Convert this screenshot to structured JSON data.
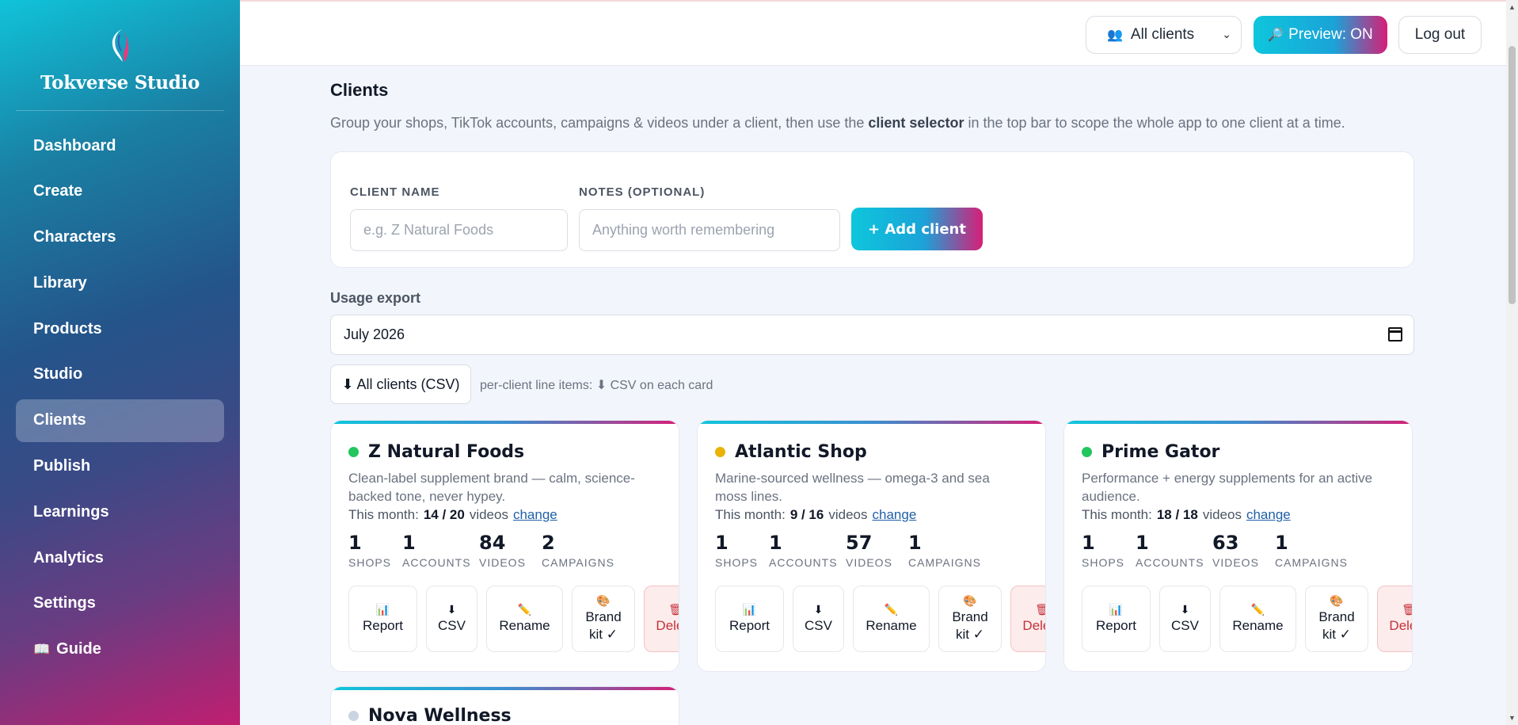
{
  "app": {
    "name": "Tokverse Studio",
    "accent_cyan": "#0ec6dc",
    "accent_pink": "#d61f77"
  },
  "sidebar": {
    "items": [
      {
        "label": "Dashboard"
      },
      {
        "label": "Create"
      },
      {
        "label": "Characters"
      },
      {
        "label": "Library"
      },
      {
        "label": "Products"
      },
      {
        "label": "Studio"
      },
      {
        "label": "Clients",
        "active": true
      },
      {
        "label": "Publish"
      },
      {
        "label": "Learnings"
      },
      {
        "label": "Analytics"
      },
      {
        "label": "Settings"
      },
      {
        "label": "Guide",
        "icon": "📖"
      }
    ]
  },
  "topbar": {
    "client_select": {
      "icon": "👥",
      "value": "All clients"
    },
    "preview": {
      "icon": "🔎",
      "label": "Preview: ON"
    },
    "logout": "Log out"
  },
  "page": {
    "title": "Clients",
    "desc_pre": "Group your shops, TikTok accounts, campaigns & videos under a client, then use the ",
    "desc_bold": "client selector",
    "desc_post": " in the top bar to scope the whole app to one client at a time."
  },
  "form": {
    "name_label": "CLIENT NAME",
    "name_placeholder": "e.g. Z Natural Foods",
    "notes_label": "NOTES (OPTIONAL)",
    "notes_placeholder": "Anything worth remembering",
    "add_button": "+ Add client"
  },
  "usage": {
    "label": "Usage export",
    "month": "July  2026",
    "csv_all_button": "⬇ All clients (CSV)",
    "hint": "per-client line items: ⬇ CSV on each card"
  },
  "stat_labels": [
    "SHOPS",
    "ACCOUNTS",
    "VIDEOS",
    "CAMPAIGNS"
  ],
  "action_labels": {
    "report": "Report",
    "csv": "CSV",
    "rename": "Rename",
    "brand_kit_1": "Brand",
    "brand_kit_2": "kit ✓",
    "delete": "Delete"
  },
  "clients": [
    {
      "name": "Z Natural Foods",
      "status_color": "#22c55e",
      "desc": "Clean-label supplement brand — calm, science-backed tone, never hypey.",
      "month_prefix": "This month:",
      "month_usage": "14 / 20",
      "month_suffix": "videos",
      "change": "change",
      "shops": "1",
      "accounts": "1",
      "videos": "84",
      "campaigns": "2"
    },
    {
      "name": "Atlantic Shop",
      "status_color": "#eab308",
      "desc": "Marine-sourced wellness — omega-3 and sea moss lines.",
      "month_prefix": "This month:",
      "month_usage": "9 / 16",
      "month_suffix": "videos",
      "change": "change",
      "shops": "1",
      "accounts": "1",
      "videos": "57",
      "campaigns": "1"
    },
    {
      "name": "Prime Gator",
      "status_color": "#22c55e",
      "desc": "Performance + energy supplements for an active audience.",
      "month_prefix": "This month:",
      "month_usage": "18 / 18",
      "month_suffix": "videos",
      "change": "change",
      "shops": "1",
      "accounts": "1",
      "videos": "63",
      "campaigns": "1"
    },
    {
      "name": "Nova Wellness",
      "status_color": "#cbd5e1"
    }
  ]
}
